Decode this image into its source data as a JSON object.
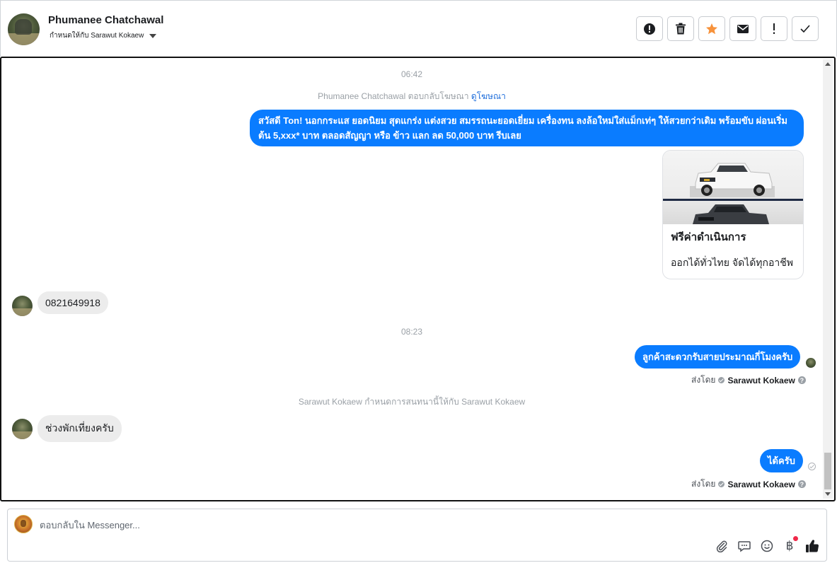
{
  "header": {
    "contact_name": "Phumanee Chatchawal",
    "assign_label": "กำหนดให้กับ Sarawut Kokaew"
  },
  "toolbar": {
    "buttons": [
      {
        "icon": "alert-circle-icon"
      },
      {
        "icon": "trash-icon"
      },
      {
        "icon": "star-icon",
        "color": "#f7923b"
      },
      {
        "icon": "envelope-icon"
      },
      {
        "icon": "exclamation-icon"
      },
      {
        "icon": "check-icon"
      }
    ]
  },
  "conversation": {
    "timestamp_1": "06:42",
    "ad_reply_note": "Phumanee Chatchawal ตอบกลับโฆษณา",
    "ad_link": "ดูโฆษณา",
    "ad_message": "สวัสดี Ton! นอกกระแส ยอดนิยม สุดแกร่ง แต่งสวย สมรรถนะยอดเยี่ยม เครื่องทน ลงล้อใหม่ใส่แม็กเท่ๆ ให้สวยกว่าเดิม พร้อมขับ ผ่อนเริ่มต้น 5,xxx* บาท ตลอดสัญญา หรือ ข้าว แลก ลด 50,000 บาท รีบเลย",
    "ad_card": {
      "title": "ฟรีค่าดำเนินการ",
      "subtitle": "ออกได้ทั่วไทย จัดได้ทุกอาชีพ"
    },
    "customer_phone": "0821649918",
    "timestamp_2": "08:23",
    "reply_1": "ลูกค้าสะดวกรับสายประมาณกี่โมงครับ",
    "sent_by_prefix": "ส่งโดย",
    "sent_by_name": "Sarawut Kokaew",
    "assign_note": "Sarawut Kokaew กำหนดการสนทนานี้ให้กับ Sarawut Kokaew",
    "customer_msg_2": "ช่วงพักเที่ยงครับ",
    "reply_2": "ได้ครับ"
  },
  "composer": {
    "placeholder": "ตอบกลับใน Messenger...",
    "icons": [
      "paperclip-icon",
      "speech-bubble-icon",
      "emoji-icon",
      "baht-icon",
      "thumbs-up-icon"
    ]
  },
  "colors": {
    "outgoing_bubble": "#0a7cff",
    "incoming_bubble": "#ececec",
    "link": "#216fdb"
  }
}
